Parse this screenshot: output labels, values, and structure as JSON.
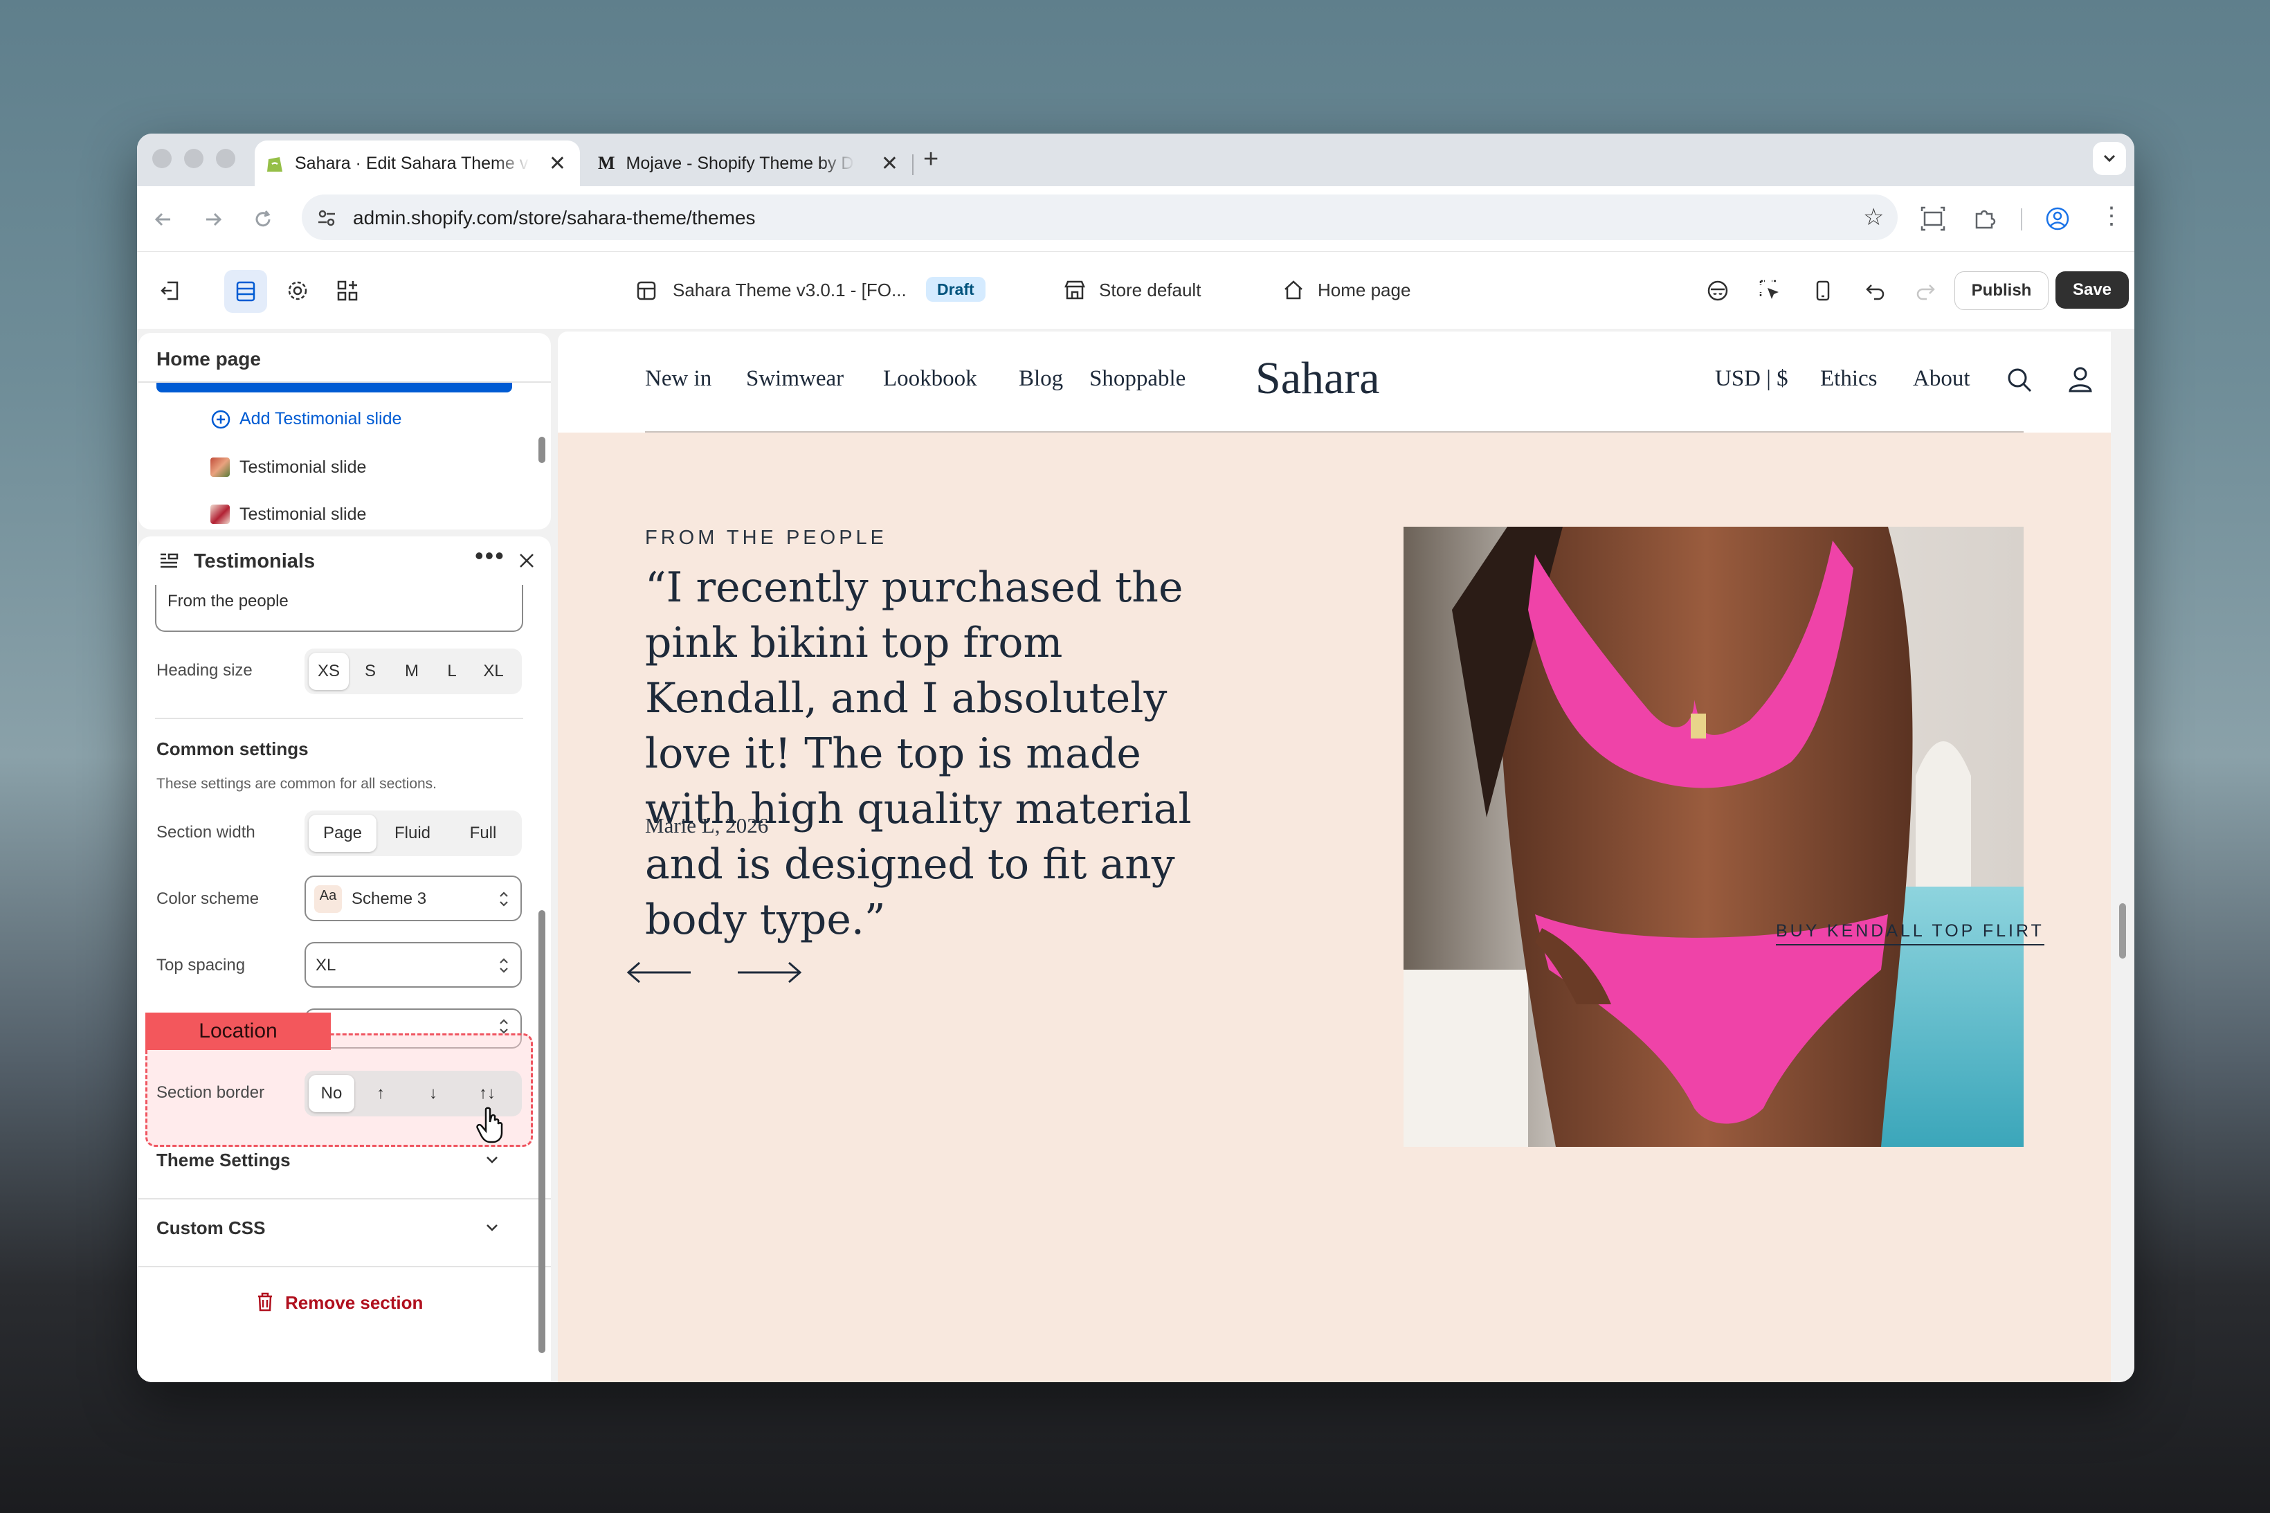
{
  "browser": {
    "tabs": [
      {
        "title": "Sahara · Edit Sahara Theme v",
        "favicon": "shopify-icon"
      },
      {
        "title": "Mojave - Shopify Theme by D",
        "favicon_text": "M"
      }
    ],
    "url": "admin.shopify.com/store/sahara-theme/themes"
  },
  "editor": {
    "theme_name": "Sahara Theme v3.0.1 - [FO...",
    "status_badge": "Draft",
    "store_selector": "Store default",
    "page_selector": "Home page",
    "publish_label": "Publish",
    "save_label": "Save"
  },
  "sidebar": {
    "tree_title": "Home page",
    "add_slide_label": "Add Testimonial slide",
    "slides": [
      "Testimonial slide",
      "Testimonial slide"
    ],
    "section_title": "Testimonials",
    "heading_value": "From the people",
    "heading_size": {
      "label": "Heading size",
      "options": [
        "XS",
        "S",
        "M",
        "L",
        "XL"
      ],
      "selected": "XS"
    },
    "common": {
      "title": "Common settings",
      "description": "These settings are common for all sections."
    },
    "section_width": {
      "label": "Section width",
      "options": [
        "Page",
        "Fluid",
        "Full"
      ],
      "selected": "Page"
    },
    "color_scheme": {
      "label": "Color scheme",
      "swatch": "Aa",
      "value": "Scheme 3"
    },
    "top_spacing": {
      "label": "Top spacing",
      "value": "XL"
    },
    "section_border": {
      "label": "Section border",
      "options": [
        "No",
        "↑",
        "↓",
        "↑↓"
      ],
      "selected": "No"
    },
    "location_tag": "Location",
    "theme_settings": "Theme Settings",
    "custom_css": "Custom CSS",
    "remove_label": "Remove section"
  },
  "store": {
    "nav_left": [
      "New in",
      "Swimwear",
      "Lookbook",
      "Blog",
      "Shoppable"
    ],
    "logo": "Sahara",
    "nav_right": [
      "USD | $",
      "Ethics",
      "About"
    ],
    "overline": "FROM THE PEOPLE",
    "quote": "“I recently purchased the pink bikini top from Kendall, and I absolutely love it! The top is made with high quality material and is designed to fit any body type.”",
    "author": "Marie L, 2026",
    "cta": "BUY KENDALL TOP FLIRT"
  },
  "colors": {
    "accent": "#005bd3",
    "hero_bg": "#f8e8de",
    "highlight": "#f3575c",
    "remove": "#b0101e"
  }
}
